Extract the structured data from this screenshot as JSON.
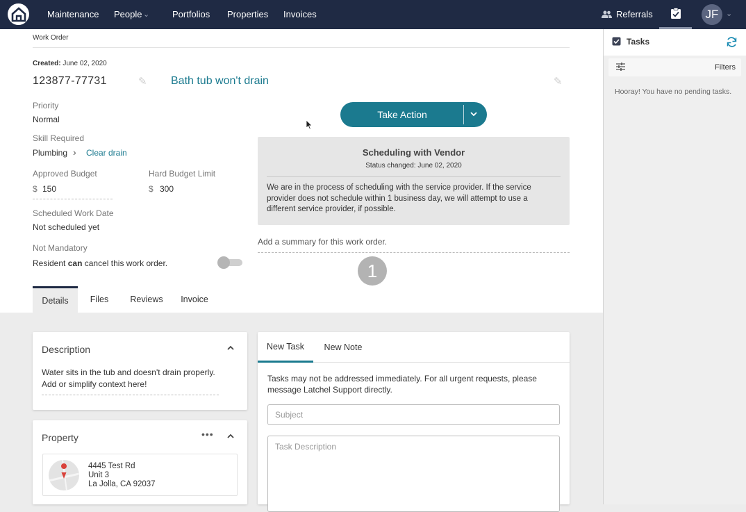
{
  "nav": {
    "items": [
      "Maintenance",
      "People",
      "Portfolios",
      "Properties",
      "Invoices"
    ],
    "referrals": "Referrals",
    "avatar_initials": "JF",
    "accent": "#1b7a8f",
    "bg": "#1f2a44"
  },
  "header": {
    "breadcrumb": "Work Order"
  },
  "workorder": {
    "created_label": "Created:",
    "created_date": "June 02, 2020",
    "id": "123877-77731",
    "title": "Bath tub won't drain",
    "priority_label": "Priority",
    "priority": "Normal",
    "skill_label": "Skill Required",
    "skill": "Plumbing",
    "subskill": "Clear drain",
    "approved_budget_label": "Approved Budget",
    "approved_budget_currency": "$",
    "approved_budget": "150",
    "hard_limit_label": "Hard Budget Limit",
    "hard_limit_currency": "$",
    "hard_limit": "300",
    "scheduled_label": "Scheduled Work Date",
    "scheduled": "Not scheduled yet",
    "mandatory_label": "Not Mandatory",
    "cancel_prefix": "Resident",
    "cancel_bold": "can",
    "cancel_suffix": "cancel this work order.",
    "summary_placeholder": "Add a summary for this work order.",
    "step_number": "1"
  },
  "action": {
    "take_action": "Take Action"
  },
  "status": {
    "title": "Scheduling with Vendor",
    "changed": "Status changed: June 02, 2020",
    "message": "We are in the process of scheduling with the service provider. If the service provider does not schedule within 1 business day, we will attempt to use a different service provider, if possible."
  },
  "tabs": [
    "Details",
    "Files",
    "Reviews",
    "Invoice"
  ],
  "description": {
    "title": "Description",
    "text": "Water sits in the tub and doesn't drain properly.",
    "hint": "Add or simplify context here!"
  },
  "property": {
    "title": "Property",
    "address1": "4445 Test Rd",
    "address2": "Unit 3",
    "address3": "La Jolla, CA 92037"
  },
  "task_form": {
    "tab_new_task": "New Task",
    "tab_new_note": "New Note",
    "notice": "Tasks may not be addressed immediately. For all urgent requests, please message Latchel Support directly.",
    "subject_placeholder": "Subject",
    "description_placeholder": "Task Description"
  },
  "sidebar": {
    "title": "Tasks",
    "filters": "Filters",
    "empty": "Hooray! You have no pending tasks."
  }
}
